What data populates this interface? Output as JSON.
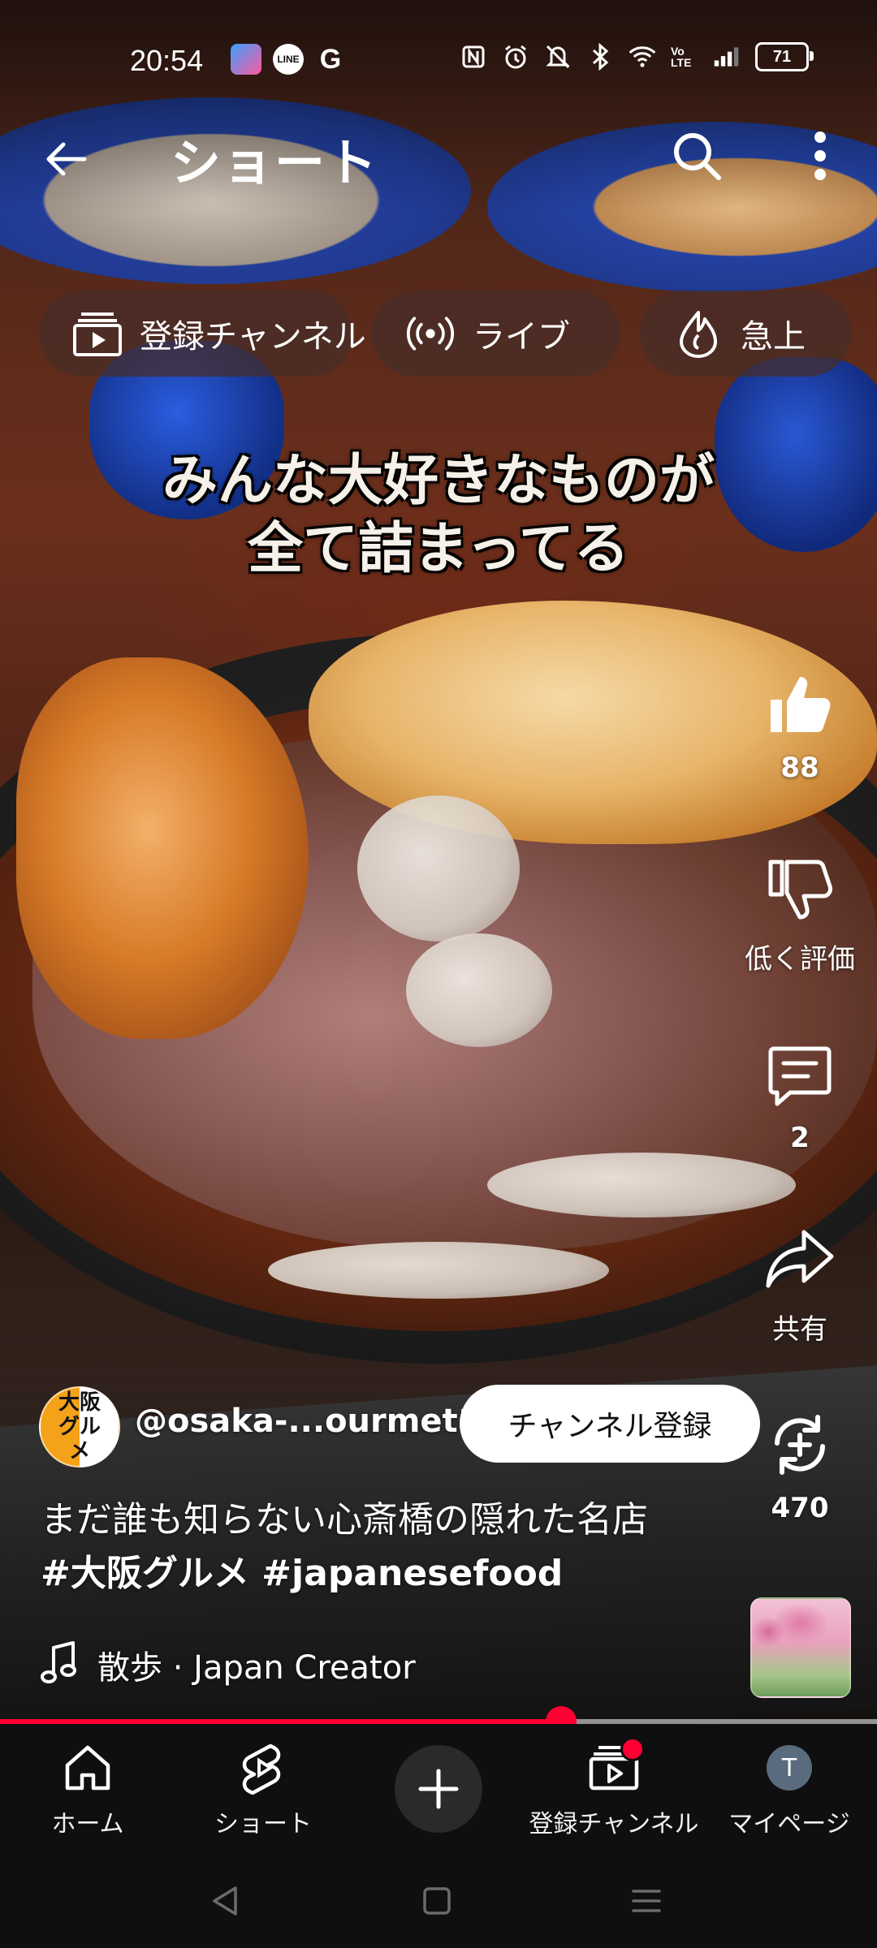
{
  "status_bar": {
    "time": "20:54",
    "apps": [
      "ai-app-icon",
      "line-app-icon",
      "google-app-icon"
    ],
    "line_label": "LINE",
    "google_label": "G",
    "battery": "71",
    "volte": "Vo LTE"
  },
  "top_bar": {
    "title": "ショート"
  },
  "chips": [
    {
      "label": "登録チャンネル",
      "icon": "subscriptions-icon"
    },
    {
      "label": "ライブ",
      "icon": "live-icon"
    },
    {
      "label": "急上",
      "icon": "trending-icon"
    }
  ],
  "video": {
    "caption_line1": "みんな大好きなものが",
    "caption_line2": "全て詰まってる"
  },
  "actions": {
    "like_count": "88",
    "dislike_label": "低く評価",
    "comment_count": "2",
    "share_label": "共有",
    "remix_count": "470"
  },
  "channel": {
    "avatar_text": "大阪グルメ",
    "handle": "@osaka-...ourmet1",
    "subscribe_label": "チャンネル登録"
  },
  "title": {
    "text": "まだ誰も知らない心斎橋の隠れた名店",
    "hashtags": "#大阪グルメ #japanesefood"
  },
  "music": {
    "label": "散歩 · Japan Creator"
  },
  "progress": {
    "fraction": 0.64
  },
  "bottom_nav": {
    "home": "ホーム",
    "shorts": "ショート",
    "subscriptions": "登録チャンネル",
    "you": "マイページ",
    "avatar_letter": "T"
  },
  "colors": {
    "accent": "#ff0033",
    "chip_bg": "#462d28",
    "nav_bg": "#0f0f0f"
  }
}
